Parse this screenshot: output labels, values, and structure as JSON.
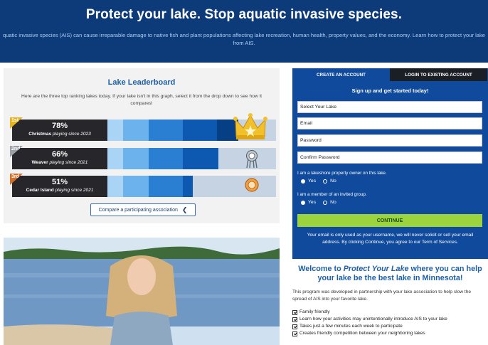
{
  "hero": {
    "title": "Protect your lake. Stop aquatic invasive species.",
    "description": "quatic invasive species (AIS) can cause irreparable damage to native fish and plant populations affecting lake recreation, human health, property values, and the economy. Learn how to protect your lake from AIS."
  },
  "leaderboard": {
    "title": "Lake Leaderboard",
    "subtitle": "Here are the three top ranking lakes today. If your lake isn't in this graph, select it from the drop down to see how it compares!",
    "rows": [
      {
        "rank": "1st",
        "percent": "78%",
        "percent_value": 78,
        "name": "Christmas",
        "since": "playing since 2023",
        "medal": "crown-icon",
        "rank_color": "#e8b21e"
      },
      {
        "rank": "2nd",
        "percent": "66%",
        "percent_value": 66,
        "name": "Weaver",
        "since": "playing since 2021",
        "medal": "silver-medal-icon",
        "rank_color": "#9aa0a6"
      },
      {
        "rank": "3rd",
        "percent": "51%",
        "percent_value": 51,
        "name": "Cedar Island",
        "since": "playing since 2021",
        "medal": "bronze-medal-icon",
        "rank_color": "#d2702a"
      }
    ],
    "compare_label": "Compare a participating association"
  },
  "signup": {
    "tab_create": "CREATE AN ACCOUNT",
    "tab_login": "LOGIN TO EXISTING ACCOUNT",
    "heading": "Sign up and get started today!",
    "select_lake": "Select Your Lake",
    "email": "Email",
    "password": "Password",
    "confirm_password": "Confirm Password",
    "q_owner": "I am a lakeshore property owner on this lake.",
    "q_group": "I am a member of an invited group.",
    "yes": "Yes",
    "no": "No",
    "continue": "CONTINUE",
    "note": "Your email is only used as your username, we will never solicit or sell your email address. By clicking Continue, you agree to our Term of Services."
  },
  "welcome": {
    "title_pre": "Welcome to ",
    "title_em": "Protect Your Lake",
    "title_post": " where you can help your lake be the best lake in Minnesota!",
    "description": "This program was developed in partnership with your lake association to help slow the spread of AIS into your favorite lake.",
    "features": [
      "Family friendly",
      "Learn how your activities may unintentionally introduce AIS to your lake",
      "Takes just a few minutes each week to participate",
      "Creates friendly competition between your neighboring lakes"
    ]
  },
  "colors": {
    "navy": "#0d3a78",
    "accent_blue": "#1d5fa7",
    "continue_green": "#9bd43d"
  }
}
